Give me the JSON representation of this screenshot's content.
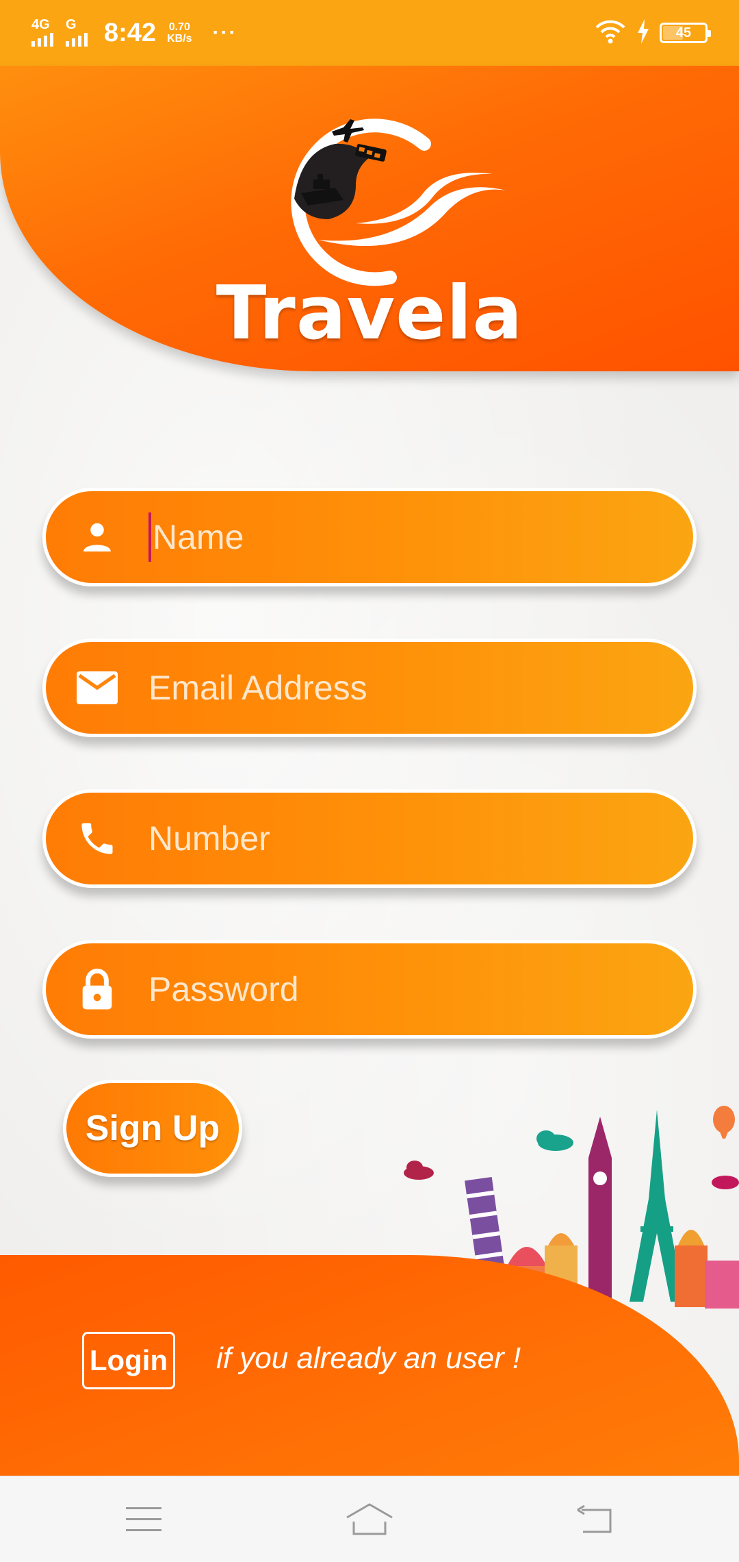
{
  "status_bar": {
    "network_1": "4G",
    "network_2": "G",
    "time": "8:42",
    "speed_value": "0.70",
    "speed_unit": "KB/s",
    "more": "···",
    "battery": "45"
  },
  "header": {
    "brand": "Travela"
  },
  "form": {
    "name_placeholder": "Name",
    "email_placeholder": "Email Address",
    "number_placeholder": "Number",
    "password_placeholder": "Password",
    "signup_label": "Sign Up"
  },
  "footer": {
    "login_label": "Login",
    "hint": "if you already an user !"
  },
  "colors": {
    "accent": "#ff7a04",
    "status_bar": "#fba512",
    "caret": "#c2185b"
  },
  "icons": [
    "person-icon",
    "mail-icon",
    "phone-icon",
    "lock-icon",
    "menu-icon",
    "home-icon",
    "back-icon"
  ]
}
